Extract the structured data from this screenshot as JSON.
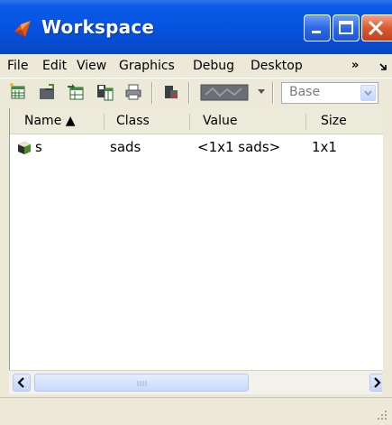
{
  "window": {
    "title": "Workspace",
    "title_bar_color": "#0552df",
    "close_button_color": "#d95a2e",
    "controls": [
      "minimize-icon",
      "maximize-icon",
      "close-icon"
    ]
  },
  "menubar": {
    "items": [
      "File",
      "Edit",
      "View",
      "Graphics",
      "Debug",
      "Desktop"
    ],
    "overflow": "»",
    "trailing_icon": "dock-arrow-icon"
  },
  "toolbar": {
    "buttons": [
      "new-variable-icon",
      "open-file-icon",
      "import-data-icon",
      "save-workspace-icon",
      "print-icon",
      "delete-icon",
      "plot-icon"
    ],
    "stack_label": "Base"
  },
  "table": {
    "columns": [
      "Name ▲",
      "Class",
      "Value",
      "Size"
    ],
    "sort_column": "Name",
    "rows": [
      {
        "icon": "object-icon",
        "name": "s",
        "class": "sads",
        "value": "<1x1 sads>",
        "size": "1x1"
      }
    ]
  },
  "scrollbar": {
    "left_arrow": "scroll-left-icon",
    "right_arrow": "scroll-right-icon"
  }
}
